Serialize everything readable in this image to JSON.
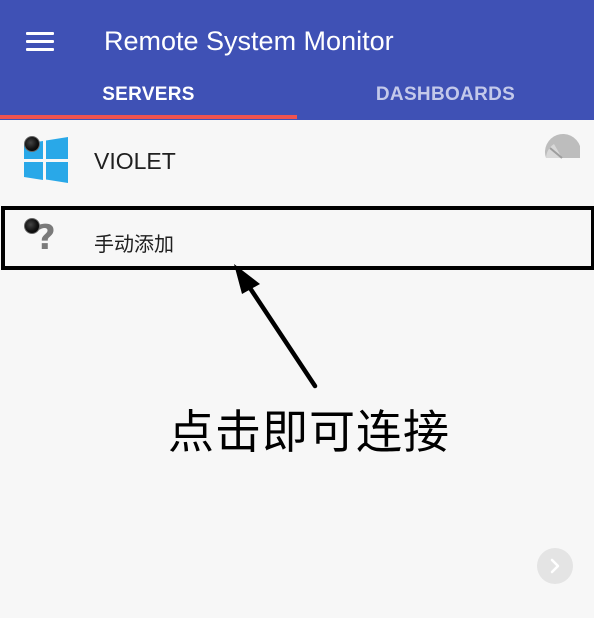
{
  "app_bar": {
    "title": "Remote System Monitor",
    "menu_icon": "hamburger-menu-icon"
  },
  "tabs": [
    {
      "label": "SERVERS",
      "selected": true
    },
    {
      "label": "DASHBOARDS",
      "selected": false
    }
  ],
  "servers": [
    {
      "name": "VIOLET",
      "os_icon": "windows-logo-icon",
      "status_icon": "status-dot-icon",
      "action_icon": "gauge-icon"
    },
    {
      "name": "手动添加",
      "os_icon": "question-mark-icon",
      "status_icon": "status-dot-icon"
    }
  ],
  "annotation": {
    "text": "点击即可连接"
  },
  "colors": {
    "app_bar": "#3f51b5",
    "tab_indicator": "#ef5350",
    "windows_blue": "#29a8e8",
    "background": "#f7f7f7"
  },
  "fab_icon": "chevron-right-icon"
}
